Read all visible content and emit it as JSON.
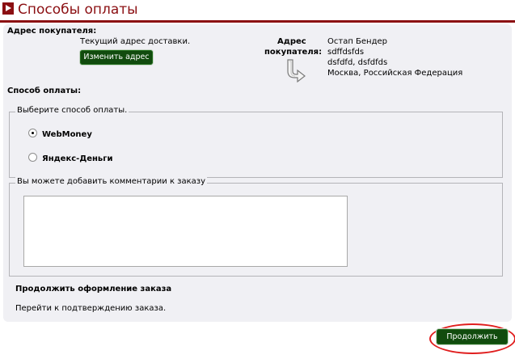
{
  "header": {
    "title": "Способы оплаты"
  },
  "address": {
    "section_label": "Адрес покупателя:",
    "current_note": "Текущий адрес доставки.",
    "change_button": "Изменить адрес",
    "side_label_line1": "Адрес",
    "side_label_line2": "покупателя:",
    "lines": [
      "Остап Бендер",
      "sdffdsfds",
      "dsfdfd, dsfdfds",
      "Москва, Российская Федерация"
    ]
  },
  "payment": {
    "section_label": "Способ оплаты:",
    "legend": "Выберите способ оплаты.",
    "options": [
      {
        "label": "WebMoney",
        "selected": true
      },
      {
        "label": "Яндекс-Деньги",
        "selected": false
      }
    ]
  },
  "comments": {
    "legend": "Вы можете добавить комментарии к заказу",
    "value": ""
  },
  "checkout": {
    "title": "Продолжить оформление заказа",
    "note": "Перейти к подтверждению заказа.",
    "continue_button": "Продолжить"
  },
  "colors": {
    "brand": "#8b0f12",
    "button": "#114b0e",
    "panel": "#f0f0f4",
    "highlight": "#e01e1e"
  }
}
